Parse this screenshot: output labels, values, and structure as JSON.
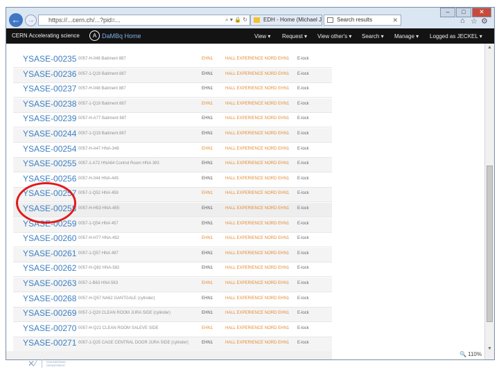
{
  "browser": {
    "address": "https://...cern.ch/...?pid=...",
    "tabs": [
      {
        "title": "EDH - Home (Michael JECKEL)"
      },
      {
        "title": "Search results"
      }
    ],
    "window_controls": {
      "minimize": "–",
      "maximize": "□",
      "close": "✕"
    },
    "zoom": "110%",
    "tool_icons": [
      "home-icon",
      "star-icon",
      "gear-icon"
    ]
  },
  "nav": {
    "brand": "CERN Accelerating science",
    "app_logo_letter": "A",
    "app_title": "DaMBq Home",
    "menu": [
      {
        "label": "View"
      },
      {
        "label": "Request"
      },
      {
        "label": "View other's"
      },
      {
        "label": "Search"
      },
      {
        "label": "Manage"
      },
      {
        "label": "Logged as JECKEL"
      }
    ]
  },
  "rows": [
    {
      "id": "YSASE-00235",
      "desc": "0057-H-048 Batiment 887",
      "zone": "EHN1",
      "hall": "HALL EXPERIENCE NORD EHN1",
      "lock": "E-lock"
    },
    {
      "id": "YSASE-00236",
      "desc": "0057-1-Q19 Batiment 887",
      "zone": "EHN1",
      "hall": "HALL EXPERIENCE NORD EHN1",
      "lock": "E-lock"
    },
    {
      "id": "YSASE-00237",
      "desc": "0057-H-048 Batiment 887",
      "zone": "EHN1",
      "hall": "HALL EXPERIENCE NORD EHN1",
      "lock": "E-lock"
    },
    {
      "id": "YSASE-00238",
      "desc": "0057-1-Q19 Batiment 887",
      "zone": "EHN1",
      "hall": "HALL EXPERIENCE NORD EHN1",
      "lock": "E-lock"
    },
    {
      "id": "YSASE-00239",
      "desc": "0057-H-A77 Batiment 887",
      "zone": "EHN1",
      "hall": "HALL EXPERIENCE NORD EHN1",
      "lock": "E-lock"
    },
    {
      "id": "YSASE-00244",
      "desc": "0057-1-Q19 Batiment 887",
      "zone": "EHN1",
      "hall": "HALL EXPERIENCE NORD EHN1",
      "lock": "E-lock"
    },
    {
      "id": "YSASE-00254",
      "desc": "0057-H-A47 HNA-348",
      "zone": "EHN1",
      "hall": "HALL EXPERIENCE NORD EHN1",
      "lock": "E-lock"
    },
    {
      "id": "YSASE-00255",
      "desc": "0057-1-A72 HNA64 Control Room HNA 393",
      "zone": "EHN1",
      "hall": "HALL EXPERIENCE NORD EHN1",
      "lock": "E-lock"
    },
    {
      "id": "YSASE-00256",
      "desc": "0057-H-044 HNA-445",
      "zone": "EHN1",
      "hall": "HALL EXPERIENCE NORD EHN1",
      "lock": "E-lock"
    },
    {
      "id": "YSASE-00257",
      "desc": "0057-1-Q52 HNA 459",
      "zone": "EHN1",
      "hall": "HALL EXPERIENCE NORD EHN1",
      "lock": "E-lock"
    },
    {
      "id": "YSASE-00258",
      "desc": "0057-H-H53 HNA-455",
      "zone": "EHN1",
      "hall": "HALL EXPERIENCE NORD EHN1",
      "lock": "E-lock"
    },
    {
      "id": "YSASE-00259",
      "desc": "0057-1-Q54 HNA 457",
      "zone": "EHN1",
      "hall": "HALL EXPERIENCE NORD EHN1",
      "lock": "E-lock"
    },
    {
      "id": "YSASE-00260",
      "desc": "0057-H-H77 HNA-492",
      "zone": "EHN1",
      "hall": "HALL EXPERIENCE NORD EHN1",
      "lock": "E-lock"
    },
    {
      "id": "YSASE-00261",
      "desc": "0057-1-Q57 HNA 497",
      "zone": "EHN1",
      "hall": "HALL EXPERIENCE NORD EHN1",
      "lock": "E-lock"
    },
    {
      "id": "YSASE-00262",
      "desc": "0057-H-Q82 HNA-582",
      "zone": "EHN1",
      "hall": "HALL EXPERIENCE NORD EHN1",
      "lock": "E-lock"
    },
    {
      "id": "YSASE-00263",
      "desc": "0057-1-B63 HNA 563",
      "zone": "EHN1",
      "hall": "HALL EXPERIENCE NORD EHN1",
      "lock": "E-lock"
    },
    {
      "id": "YSASE-00268",
      "desc": "0057-H-Q57 NA62 GANTGALE (cylinder)",
      "zone": "EHN1",
      "hall": "HALL EXPERIENCE NORD EHN1",
      "lock": "E-lock"
    },
    {
      "id": "YSASE-00269",
      "desc": "0057-1-Q20 CLEAN ROOM JURA SIDE (cylinder)",
      "zone": "EHN1",
      "hall": "HALL EXPERIENCE NORD EHN1",
      "lock": "E-lock"
    },
    {
      "id": "YSASE-00270",
      "desc": "0057-H-Q21 CLEAN ROOM SALEVE SIDE",
      "zone": "EHN1",
      "hall": "HALL EXPERIENCE NORD EHN1",
      "lock": "E-lock"
    },
    {
      "id": "YSASE-00271",
      "desc": "0057-1-Q25 CAGE CENTRAL DOOR JURA SIDE (cylinder)",
      "zone": "EHN1",
      "hall": "HALL EXPERIENCE NORD EHN1",
      "lock": "E-lock"
    }
  ],
  "colors": {
    "link": "#3e7fc1",
    "accent_orange": "#e58a33",
    "annotation": "#e21a1a",
    "navbar": "#131313"
  },
  "footer": {
    "org_lines": [
      "ENGINEERING",
      "DEPARTMENT"
    ]
  }
}
